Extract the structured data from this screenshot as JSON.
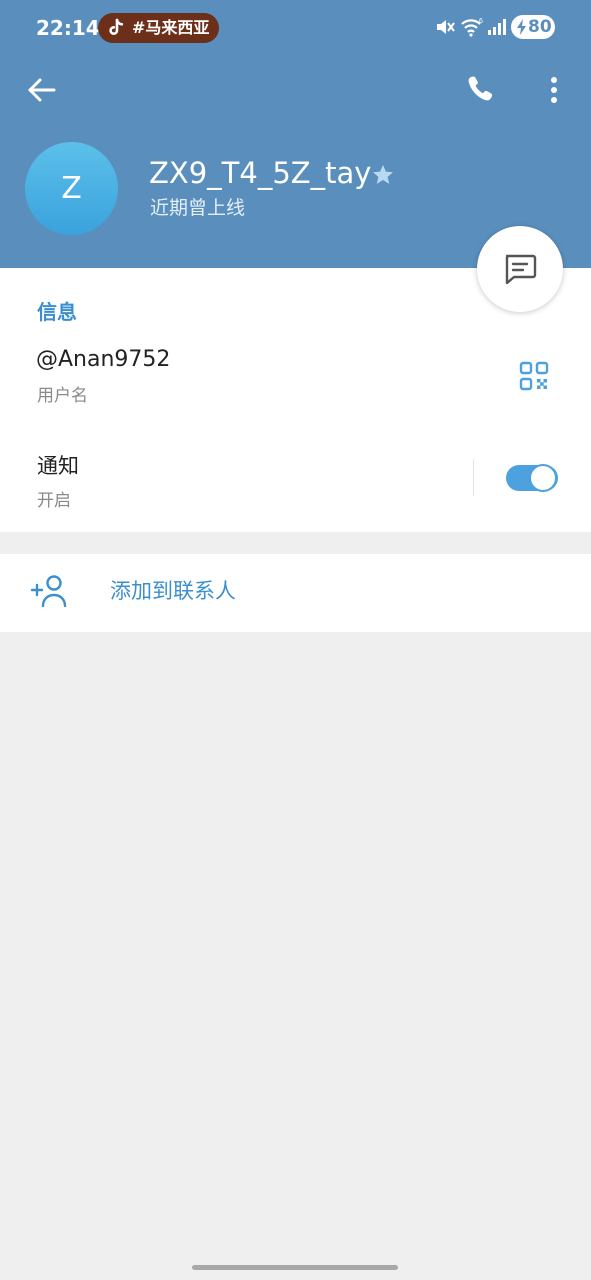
{
  "status_bar": {
    "time": "22:14",
    "tiktok_tag": "#马来西亚",
    "battery": "80"
  },
  "toolbar": {
    "back_icon": "arrow-left-icon",
    "call_icon": "phone-icon",
    "more_icon": "more-vertical-icon"
  },
  "profile": {
    "avatar_letter": "Z",
    "name": "ZX9_T4_5Z_tay",
    "status": "近期曾上线",
    "badge_icon": "star-icon"
  },
  "fab": {
    "icon": "message-icon"
  },
  "info": {
    "section_title": "信息",
    "username": "@Anan9752",
    "username_label": "用户名",
    "qr_icon": "qr-code-icon",
    "notifications_title": "通知",
    "notifications_value": "开启",
    "notifications_enabled": true
  },
  "actions": {
    "add_contact_label": "添加到联系人",
    "add_contact_icon": "add-user-icon"
  },
  "colors": {
    "header": "#5a8fbd",
    "accent": "#3b8fce",
    "toggle": "#4da1de",
    "background": "#efefef"
  }
}
